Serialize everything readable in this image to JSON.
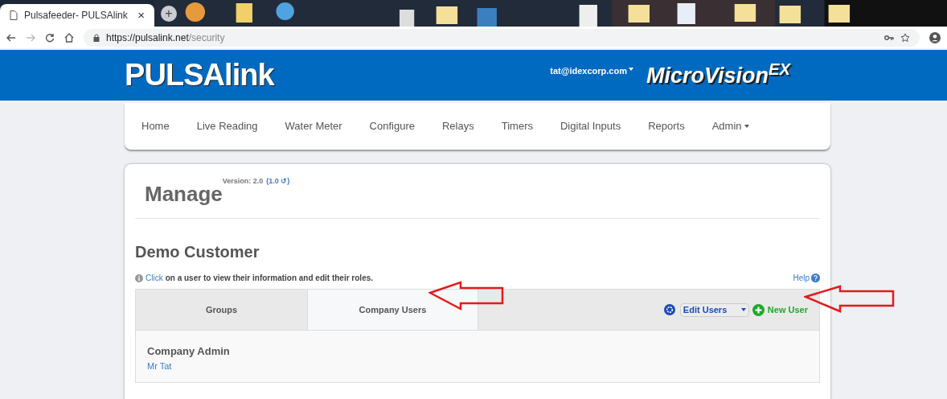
{
  "browser": {
    "tab_title": "Pulsafeeder- PULSAlink",
    "tab_close": "×",
    "new_tab": "+",
    "url_host": "https://pulsalink.net",
    "url_path": "/security"
  },
  "header": {
    "logo": "PULSAlink",
    "account": "tat@idexcorp.com",
    "product": "MicroVision$^{EX}$"
  },
  "nav": [
    {
      "label": "Home",
      "dropdown": false
    },
    {
      "label": "Live Reading",
      "dropdown": false
    },
    {
      "label": "Water Meter",
      "dropdown": false
    },
    {
      "label": "Configure",
      "dropdown": false
    },
    {
      "label": "Relays",
      "dropdown": false
    },
    {
      "label": "Timers",
      "dropdown": false
    },
    {
      "label": "Digital Inputs",
      "dropdown": false
    },
    {
      "label": "Reports",
      "dropdown": false
    },
    {
      "label": "Admin",
      "dropdown": true
    }
  ],
  "page": {
    "title": "Manage",
    "version": "Version: 2.0",
    "version_link": "(1.0 ↺)",
    "customer": "Demo Customer",
    "hint_link": "Click",
    "hint": "on a user to view their information and edit their roles.",
    "help": "Help"
  },
  "tabs": [
    {
      "label": "Groups",
      "selected": false
    },
    {
      "label": "Company Users",
      "selected": true
    }
  ],
  "toolbar": {
    "select_value": "Edit Users",
    "new_user": "New User"
  },
  "groups": [
    {
      "name": "Company Admin",
      "users": [
        "Mr Tat"
      ]
    }
  ]
}
